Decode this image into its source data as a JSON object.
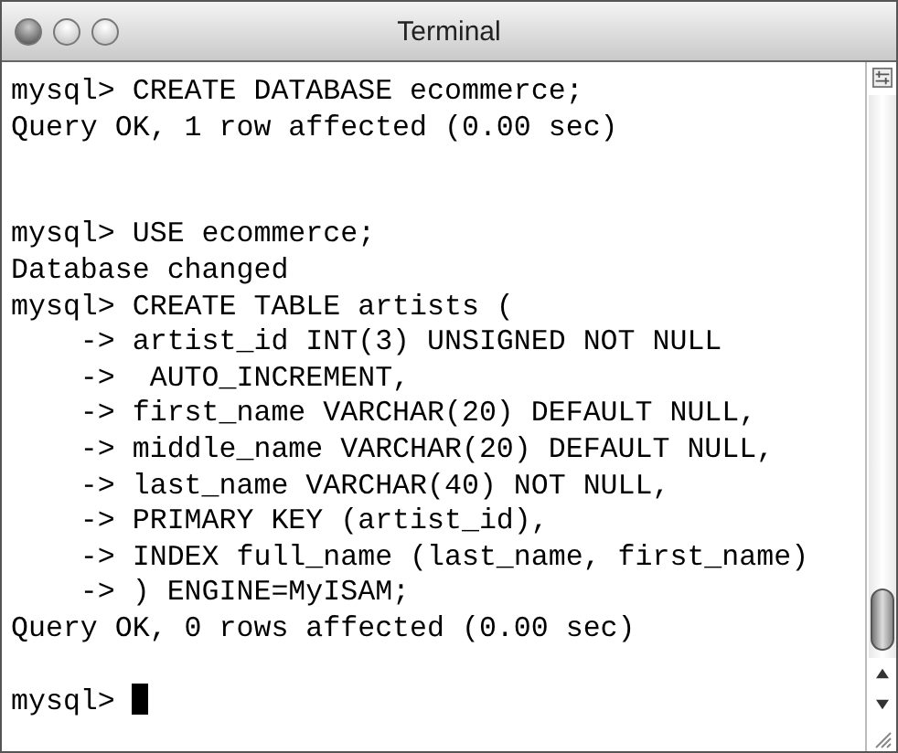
{
  "window": {
    "title": "Terminal"
  },
  "terminal": {
    "lines": [
      {
        "kind": "text",
        "text": "mysql> CREATE DATABASE ecommerce;"
      },
      {
        "kind": "text",
        "text": "Query OK, 1 row affected (0.00 sec)"
      },
      {
        "kind": "blank"
      },
      {
        "kind": "blank"
      },
      {
        "kind": "text",
        "text": "mysql> USE ecommerce;"
      },
      {
        "kind": "text",
        "text": "Database changed"
      },
      {
        "kind": "text",
        "text": "mysql> CREATE TABLE artists ("
      },
      {
        "kind": "text",
        "text": "    -> artist_id INT(3) UNSIGNED NOT NULL"
      },
      {
        "kind": "text",
        "text": "    ->  AUTO_INCREMENT,"
      },
      {
        "kind": "text",
        "text": "    -> first_name VARCHAR(20) DEFAULT NULL,"
      },
      {
        "kind": "text",
        "text": "    -> middle_name VARCHAR(20) DEFAULT NULL,"
      },
      {
        "kind": "text",
        "text": "    -> last_name VARCHAR(40) NOT NULL,"
      },
      {
        "kind": "text",
        "text": "    -> PRIMARY KEY (artist_id),"
      },
      {
        "kind": "text",
        "text": "    -> INDEX full_name (last_name, first_name)"
      },
      {
        "kind": "text",
        "text": "    -> ) ENGINE=MyISAM;"
      },
      {
        "kind": "text",
        "text": "Query OK, 0 rows affected (0.00 sec)"
      },
      {
        "kind": "blank"
      },
      {
        "kind": "prompt",
        "text": "mysql>"
      }
    ]
  }
}
